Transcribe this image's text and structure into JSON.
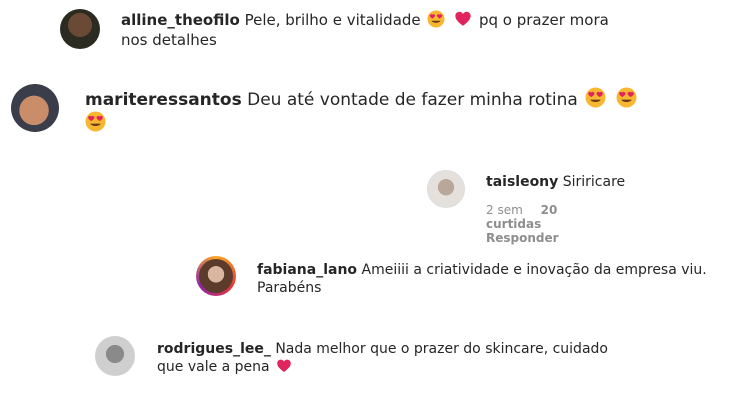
{
  "comments": [
    {
      "username": "alline_theofilo",
      "text_before": "Pele, brilho e vitalidade",
      "text_after": "pq o prazer mora",
      "text_line2": "nos detalhes"
    },
    {
      "username": "mariteressantos",
      "text": "Deu até vontade de fazer minha rotina"
    },
    {
      "username": "taisleony",
      "text": "Siriricare",
      "time": "2 sem",
      "likes": "20 curtidas",
      "reply": "Responder"
    },
    {
      "username": "fabiana_lano",
      "text": "Ameiiii a criatividade e inovação da empresa viu.",
      "text_line2": "Parabéns"
    },
    {
      "username": "rodrigues_lee_",
      "text": "Nada melhor que o prazer do skincare, cuidado",
      "text_line2": "que vale a pena"
    }
  ],
  "icons": {
    "heart_eyes": "smiling-face-with-heart-eyes-icon",
    "heart": "red-heart-icon"
  },
  "colors": {
    "heart": "#e0245e",
    "emoji_face": "#f7b731",
    "meta": "#8e8e8e"
  }
}
